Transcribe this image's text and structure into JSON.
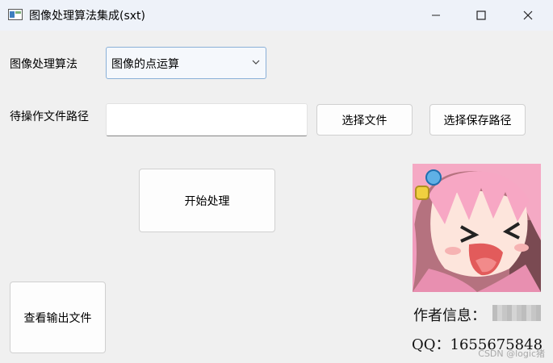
{
  "window": {
    "title": "图像处理算法集成(sxt)"
  },
  "form": {
    "algorithm_label": "图像处理算法",
    "algorithm_selected": "图像的点运算",
    "file_path_label": "待操作文件路径",
    "file_path_value": ""
  },
  "buttons": {
    "choose_file": "选择文件",
    "choose_save_path": "选择保存路径",
    "start": "开始处理",
    "view_output": "查看输出文件"
  },
  "author": {
    "label": "作者信息：",
    "qq": "QQ：1655675848"
  },
  "watermark": "CSDN @logic猪",
  "colors": {
    "accent_border": "#8ab0d8",
    "titlebar": "#eef2f9",
    "background": "#f0f0f0"
  }
}
